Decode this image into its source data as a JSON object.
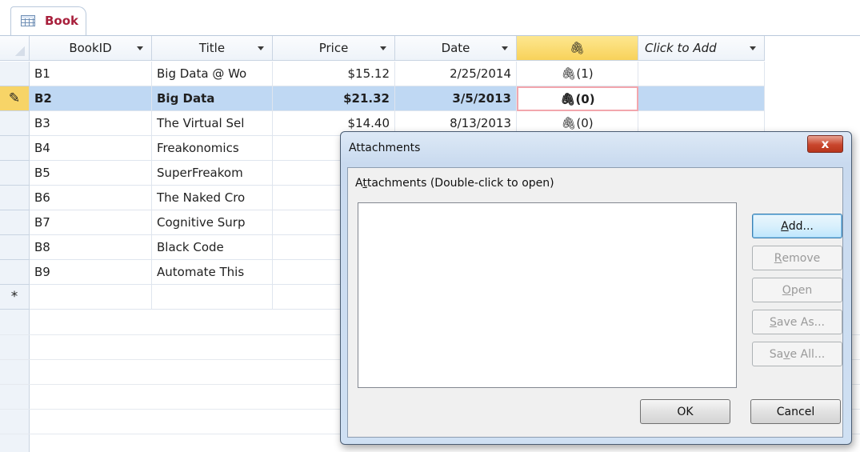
{
  "tab": {
    "label": "Book",
    "icon": "table-icon"
  },
  "columns": [
    {
      "label": "BookID",
      "dropdown": true
    },
    {
      "label": "Title",
      "dropdown": true
    },
    {
      "label": "Price",
      "dropdown": true
    },
    {
      "label": "Date",
      "dropdown": true
    },
    {
      "label": "",
      "icon": "paperclip-icon",
      "dropdown": false
    },
    {
      "label": "Click to Add",
      "dropdown": true
    }
  ],
  "rows": [
    {
      "id": "B1",
      "title": "Big Data @ Wo",
      "price": "$15.12",
      "date": "2/25/2014",
      "attach": "(1)"
    },
    {
      "id": "B2",
      "title": "Big Data",
      "price": "$21.32",
      "date": "3/5/2013",
      "attach": "(0)",
      "current": true,
      "selector": "pencil-icon"
    },
    {
      "id": "B3",
      "title": "The Virtual Sel",
      "price": "$14.40",
      "date": "8/13/2013",
      "attach": "(0)"
    },
    {
      "id": "B4",
      "title": "Freakonomics"
    },
    {
      "id": "B5",
      "title": "SuperFreakom"
    },
    {
      "id": "B6",
      "title": "The Naked Cro"
    },
    {
      "id": "B7",
      "title": "Cognitive Surp"
    },
    {
      "id": "B8",
      "title": "Black Code"
    },
    {
      "id": "B9",
      "title": "Automate This"
    }
  ],
  "new_row_marker": "*",
  "dialog": {
    "title": "Attachments",
    "close_label": "x",
    "list_label_pre": "A",
    "list_label_access": "t",
    "list_label_post": "tachments (Double-click to open)",
    "buttons": {
      "add_access": "A",
      "add_rest": "dd...",
      "remove_access": "R",
      "remove_rest": "emove",
      "open_access": "O",
      "open_rest": "pen",
      "saveas_access": "S",
      "saveas_rest": "ave As...",
      "saveall_pre": "Sa",
      "saveall_access": "v",
      "saveall_rest": "e All...",
      "ok": "OK",
      "cancel": "Cancel"
    }
  },
  "colors": {
    "current_row": "#bfd8f3",
    "attach_header": "#f8d25a",
    "tab_label": "#a8203c"
  }
}
